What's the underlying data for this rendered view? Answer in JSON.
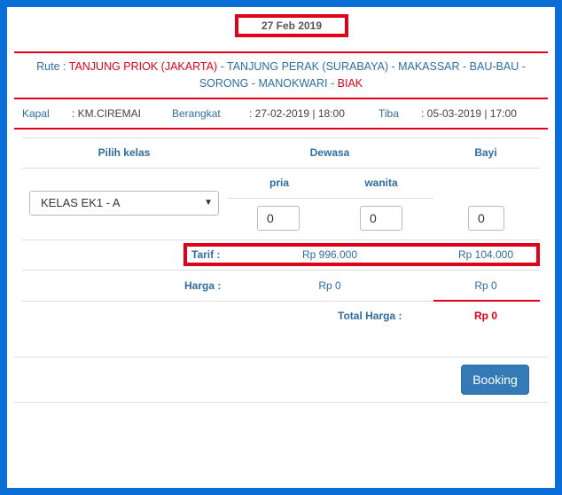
{
  "header": {
    "date": "27 Feb 2019"
  },
  "route": {
    "prefix": "Rute : ",
    "origin": "TANJUNG PRIOK (JAKARTA)",
    "middle": " - TANJUNG PERAK (SURABAYA) - MAKASSAR - BAU-BAU - SORONG - MANOKWARI - ",
    "destination": "BIAK"
  },
  "voyage": {
    "ship_label": "Kapal",
    "ship_value": ": KM.CIREMAI",
    "depart_label": "Berangkat",
    "depart_value": ": 27-02-2019 | 18:00",
    "arrive_label": "Tiba",
    "arrive_value": ": 05-03-2019 | 17:00"
  },
  "table": {
    "col_class": "Pilih kelas",
    "col_adult": "Dewasa",
    "col_infant": "Bayi",
    "sub_male": "pria",
    "sub_female": "wanita",
    "class_selected": "KELAS EK1 - A",
    "qty_male": "0",
    "qty_female": "0",
    "qty_infant": "0"
  },
  "pricing": {
    "tarif_label": "Tarif :",
    "tarif_adult": "Rp 996.000",
    "tarif_infant": "Rp 104.000",
    "harga_label": "Harga :",
    "harga_adult": "Rp 0",
    "harga_infant": "Rp 0",
    "total_label": "Total Harga :",
    "total_value": "Rp 0"
  },
  "actions": {
    "booking_label": "Booking"
  },
  "colors": {
    "accent_red": "#e0001a",
    "brand_blue": "#2e6da4",
    "background": "#0b6ed6"
  }
}
